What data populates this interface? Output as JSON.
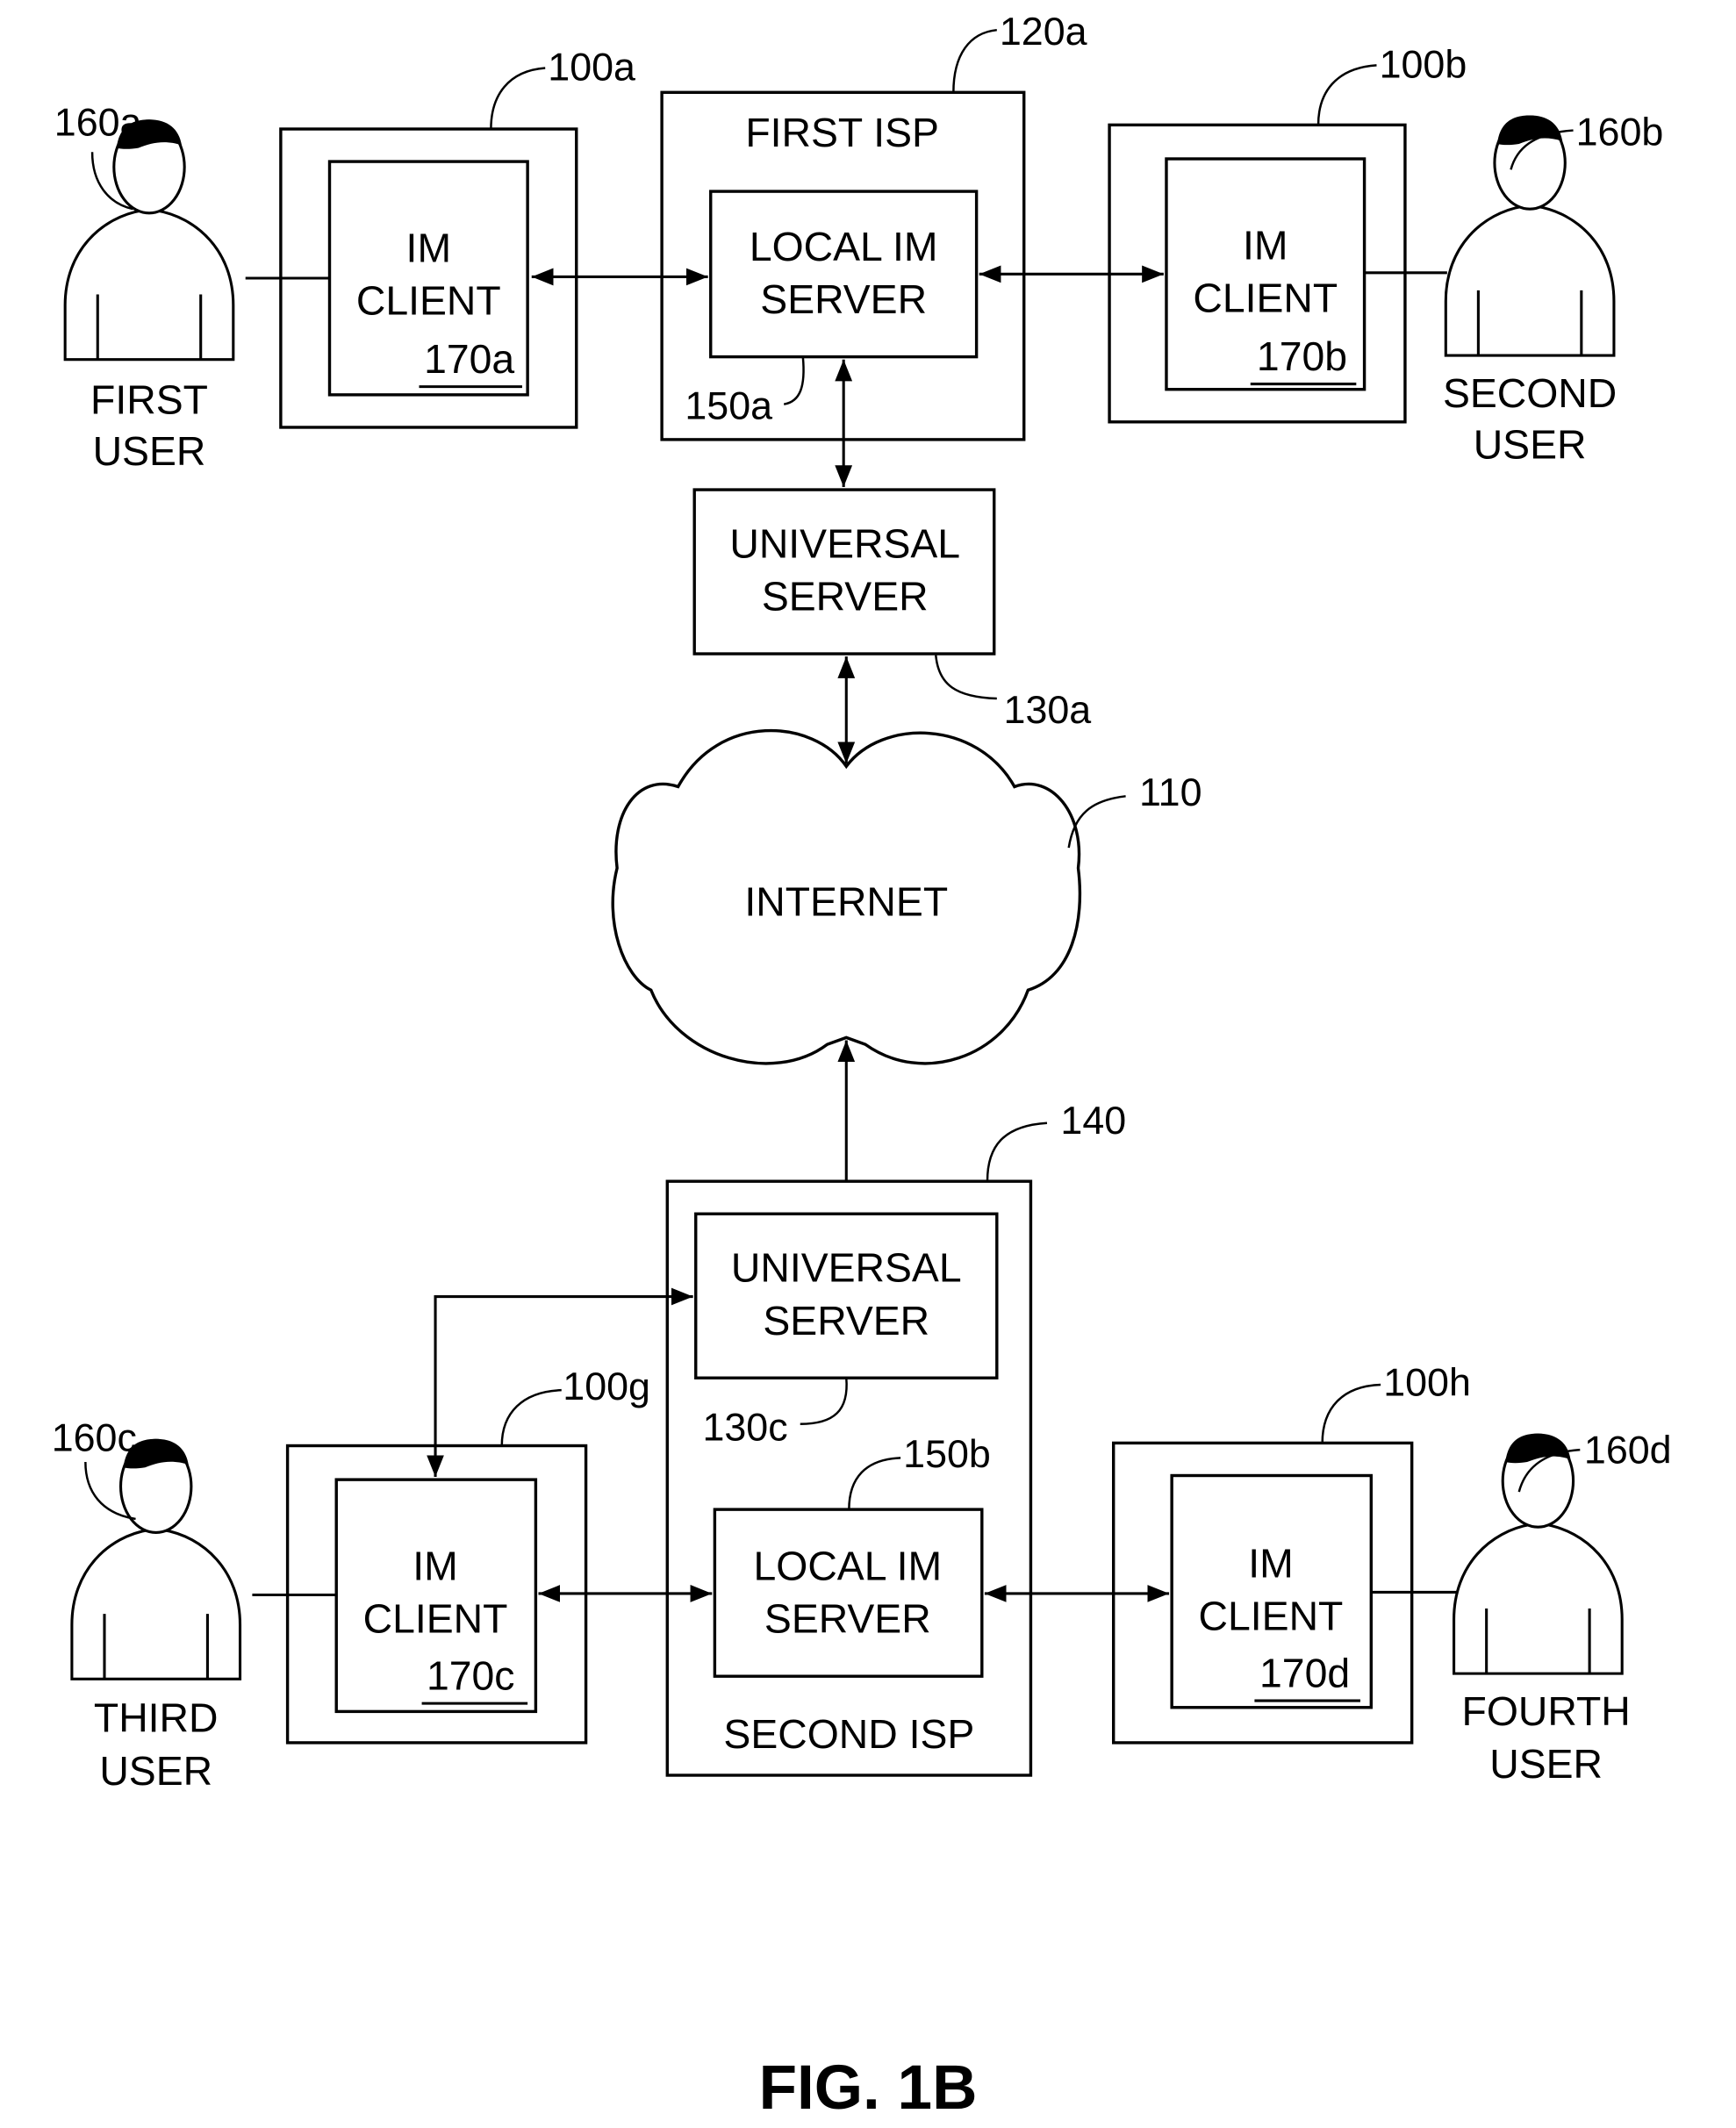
{
  "figure_label": "FIG. 1B",
  "network": {
    "label": "INTERNET",
    "ref": "110"
  },
  "isps": [
    {
      "id": "first-isp",
      "label": "FIRST ISP",
      "ref": "120a",
      "local_server": {
        "line1": "LOCAL IM",
        "line2": "SERVER",
        "ref": "150a"
      },
      "universal_server": {
        "line1": "UNIVERSAL",
        "line2": "SERVER",
        "ref": "130a"
      }
    },
    {
      "id": "second-isp",
      "label": "SECOND ISP",
      "ref": "140",
      "local_server": {
        "line1": "LOCAL IM",
        "line2": "SERVER",
        "ref": "150b"
      },
      "universal_server": {
        "line1": "UNIVERSAL",
        "line2": "SERVER",
        "ref": "130c"
      }
    }
  ],
  "clients": [
    {
      "line1": "IM",
      "line2": "CLIENT",
      "ref": "170a",
      "device_ref": "100a"
    },
    {
      "line1": "IM",
      "line2": "CLIENT",
      "ref": "170b",
      "device_ref": "100b"
    },
    {
      "line1": "IM",
      "line2": "CLIENT",
      "ref": "170c",
      "device_ref": "100g"
    },
    {
      "line1": "IM",
      "line2": "CLIENT",
      "ref": "170d",
      "device_ref": "100h"
    }
  ],
  "users": [
    {
      "line1": "FIRST",
      "line2": "USER",
      "ref": "160a"
    },
    {
      "line1": "SECOND",
      "line2": "USER",
      "ref": "160b"
    },
    {
      "line1": "THIRD",
      "line2": "USER",
      "ref": "160c"
    },
    {
      "line1": "FOURTH",
      "line2": "USER",
      "ref": "160d"
    }
  ]
}
